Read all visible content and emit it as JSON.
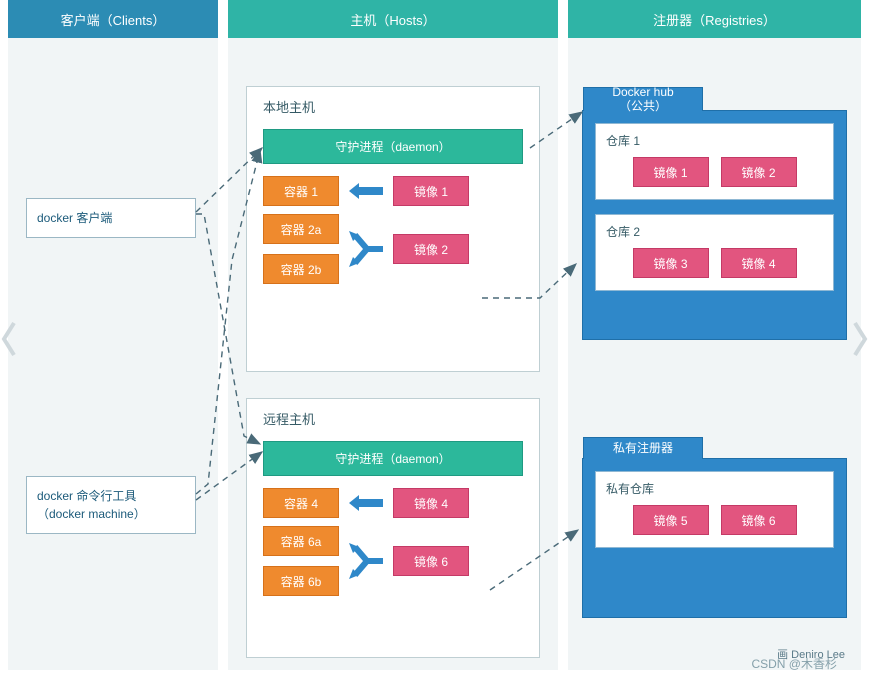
{
  "columns": {
    "clients": "客户端（Clients）",
    "hosts": "主机（Hosts）",
    "registries": "注册器（Registries）"
  },
  "clients": {
    "box1": "docker 客户端",
    "box2_line1": "docker 命令行工具",
    "box2_line2": "（docker machine）"
  },
  "hosts": {
    "local": {
      "title": "本地主机",
      "daemon": "守护进程（daemon）",
      "container1": "容器 1",
      "image1": "镜像 1",
      "container2a": "容器 2a",
      "container2b": "容器 2b",
      "image2": "镜像 2"
    },
    "remote": {
      "title": "远程主机",
      "daemon": "守护进程（daemon）",
      "container4": "容器 4",
      "image4": "镜像 4",
      "container6a": "容器 6a",
      "container6b": "容器 6b",
      "image6": "镜像 6"
    }
  },
  "registries": {
    "hub": {
      "tab_line1": "Docker hub",
      "tab_line2": "（公共）",
      "repo1": {
        "title": "仓库 1",
        "img1": "镜像 1",
        "img2": "镜像 2"
      },
      "repo2": {
        "title": "仓库 2",
        "img3": "镜像 3",
        "img4": "镜像 4"
      }
    },
    "private": {
      "tab": "私有注册器",
      "repo": {
        "title": "私有仓库",
        "img5": "镜像 5",
        "img6": "镜像 6"
      }
    }
  },
  "credit": "画    Deniro Lee",
  "watermark": "CSDN @木香杉"
}
